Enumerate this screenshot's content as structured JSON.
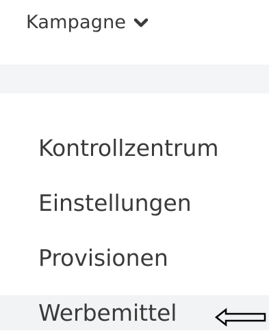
{
  "dropdown": {
    "label": "Kampagne",
    "icon": "chevron-down-icon"
  },
  "menu": {
    "items": [
      {
        "label": "Kontrollzentrum"
      },
      {
        "label": "Einstellungen"
      },
      {
        "label": "Provisionen"
      },
      {
        "label": "Werbemittel",
        "active": true
      }
    ]
  },
  "annotation": {
    "icon": "left-arrow-icon",
    "color": "#000000"
  }
}
